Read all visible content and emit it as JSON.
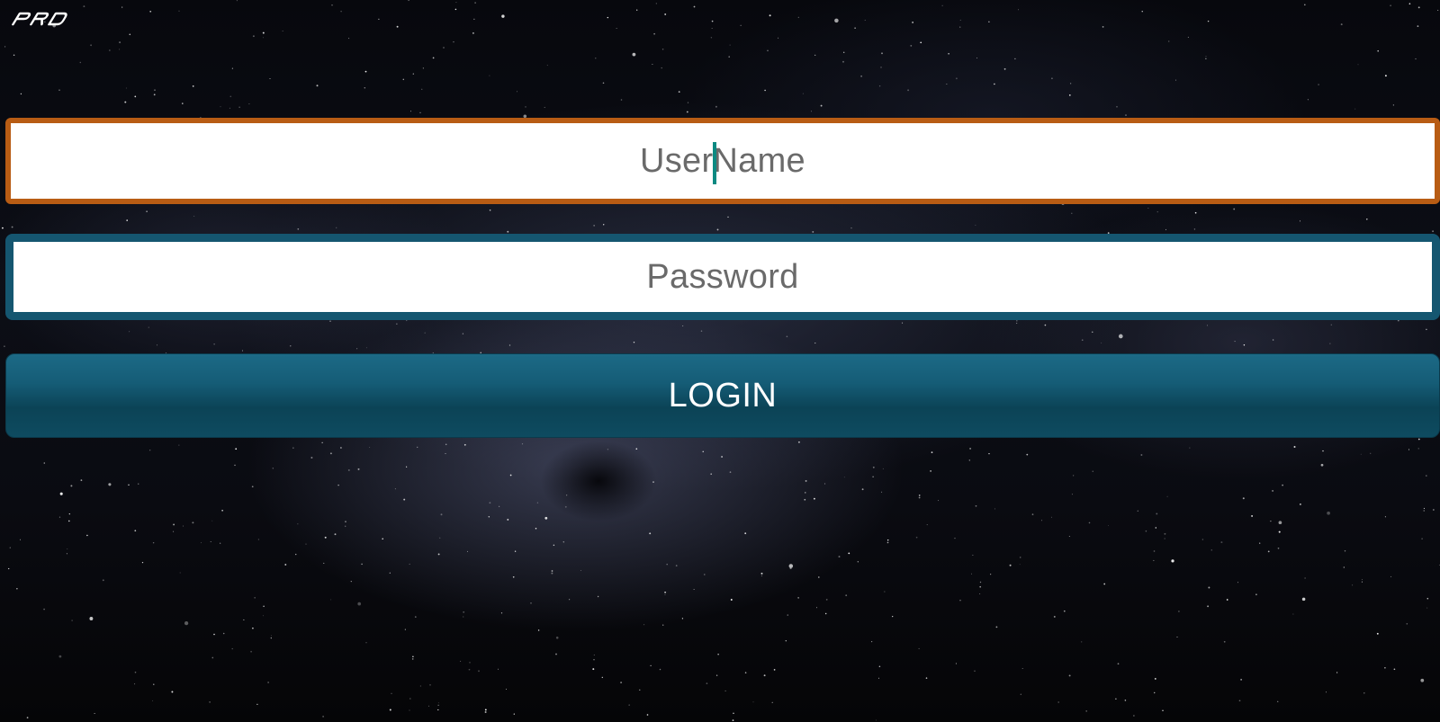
{
  "app": {
    "logo_text": "PRO"
  },
  "login_form": {
    "username": {
      "placeholder": "UserName",
      "value": "",
      "focused": true,
      "border_color": "#b85c14",
      "caret_color": "#0c8a82"
    },
    "password": {
      "placeholder": "Password",
      "value": "",
      "border_color": "#155670"
    },
    "submit": {
      "label": "LOGIN",
      "color": "#155c76"
    }
  },
  "theme": {
    "background": "starfield",
    "accent_orange": "#b85c14",
    "accent_teal": "#155670"
  }
}
